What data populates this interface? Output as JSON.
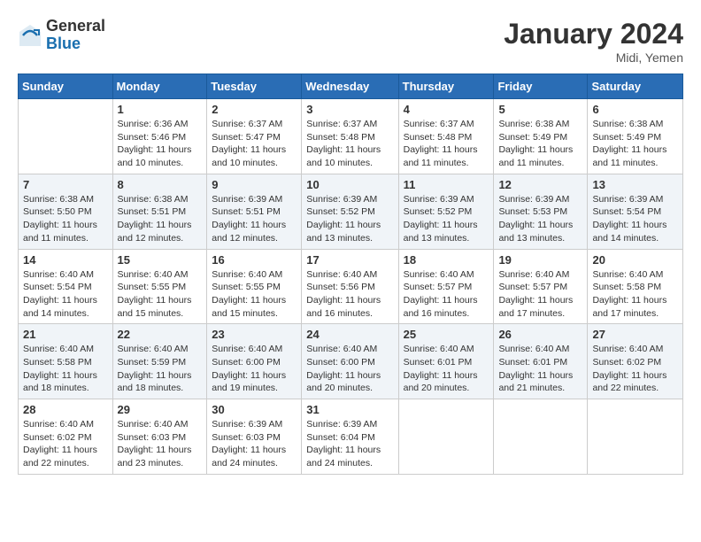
{
  "logo": {
    "general": "General",
    "blue": "Blue"
  },
  "title": "January 2024",
  "location": "Midi, Yemen",
  "headers": [
    "Sunday",
    "Monday",
    "Tuesday",
    "Wednesday",
    "Thursday",
    "Friday",
    "Saturday"
  ],
  "weeks": [
    [
      {
        "day": "",
        "sunrise": "",
        "sunset": "",
        "daylight": ""
      },
      {
        "day": "1",
        "sunrise": "Sunrise: 6:36 AM",
        "sunset": "Sunset: 5:46 PM",
        "daylight": "Daylight: 11 hours and 10 minutes."
      },
      {
        "day": "2",
        "sunrise": "Sunrise: 6:37 AM",
        "sunset": "Sunset: 5:47 PM",
        "daylight": "Daylight: 11 hours and 10 minutes."
      },
      {
        "day": "3",
        "sunrise": "Sunrise: 6:37 AM",
        "sunset": "Sunset: 5:48 PM",
        "daylight": "Daylight: 11 hours and 10 minutes."
      },
      {
        "day": "4",
        "sunrise": "Sunrise: 6:37 AM",
        "sunset": "Sunset: 5:48 PM",
        "daylight": "Daylight: 11 hours and 11 minutes."
      },
      {
        "day": "5",
        "sunrise": "Sunrise: 6:38 AM",
        "sunset": "Sunset: 5:49 PM",
        "daylight": "Daylight: 11 hours and 11 minutes."
      },
      {
        "day": "6",
        "sunrise": "Sunrise: 6:38 AM",
        "sunset": "Sunset: 5:49 PM",
        "daylight": "Daylight: 11 hours and 11 minutes."
      }
    ],
    [
      {
        "day": "7",
        "sunrise": "Sunrise: 6:38 AM",
        "sunset": "Sunset: 5:50 PM",
        "daylight": "Daylight: 11 hours and 11 minutes."
      },
      {
        "day": "8",
        "sunrise": "Sunrise: 6:38 AM",
        "sunset": "Sunset: 5:51 PM",
        "daylight": "Daylight: 11 hours and 12 minutes."
      },
      {
        "day": "9",
        "sunrise": "Sunrise: 6:39 AM",
        "sunset": "Sunset: 5:51 PM",
        "daylight": "Daylight: 11 hours and 12 minutes."
      },
      {
        "day": "10",
        "sunrise": "Sunrise: 6:39 AM",
        "sunset": "Sunset: 5:52 PM",
        "daylight": "Daylight: 11 hours and 13 minutes."
      },
      {
        "day": "11",
        "sunrise": "Sunrise: 6:39 AM",
        "sunset": "Sunset: 5:52 PM",
        "daylight": "Daylight: 11 hours and 13 minutes."
      },
      {
        "day": "12",
        "sunrise": "Sunrise: 6:39 AM",
        "sunset": "Sunset: 5:53 PM",
        "daylight": "Daylight: 11 hours and 13 minutes."
      },
      {
        "day": "13",
        "sunrise": "Sunrise: 6:39 AM",
        "sunset": "Sunset: 5:54 PM",
        "daylight": "Daylight: 11 hours and 14 minutes."
      }
    ],
    [
      {
        "day": "14",
        "sunrise": "Sunrise: 6:40 AM",
        "sunset": "Sunset: 5:54 PM",
        "daylight": "Daylight: 11 hours and 14 minutes."
      },
      {
        "day": "15",
        "sunrise": "Sunrise: 6:40 AM",
        "sunset": "Sunset: 5:55 PM",
        "daylight": "Daylight: 11 hours and 15 minutes."
      },
      {
        "day": "16",
        "sunrise": "Sunrise: 6:40 AM",
        "sunset": "Sunset: 5:55 PM",
        "daylight": "Daylight: 11 hours and 15 minutes."
      },
      {
        "day": "17",
        "sunrise": "Sunrise: 6:40 AM",
        "sunset": "Sunset: 5:56 PM",
        "daylight": "Daylight: 11 hours and 16 minutes."
      },
      {
        "day": "18",
        "sunrise": "Sunrise: 6:40 AM",
        "sunset": "Sunset: 5:57 PM",
        "daylight": "Daylight: 11 hours and 16 minutes."
      },
      {
        "day": "19",
        "sunrise": "Sunrise: 6:40 AM",
        "sunset": "Sunset: 5:57 PM",
        "daylight": "Daylight: 11 hours and 17 minutes."
      },
      {
        "day": "20",
        "sunrise": "Sunrise: 6:40 AM",
        "sunset": "Sunset: 5:58 PM",
        "daylight": "Daylight: 11 hours and 17 minutes."
      }
    ],
    [
      {
        "day": "21",
        "sunrise": "Sunrise: 6:40 AM",
        "sunset": "Sunset: 5:58 PM",
        "daylight": "Daylight: 11 hours and 18 minutes."
      },
      {
        "day": "22",
        "sunrise": "Sunrise: 6:40 AM",
        "sunset": "Sunset: 5:59 PM",
        "daylight": "Daylight: 11 hours and 18 minutes."
      },
      {
        "day": "23",
        "sunrise": "Sunrise: 6:40 AM",
        "sunset": "Sunset: 6:00 PM",
        "daylight": "Daylight: 11 hours and 19 minutes."
      },
      {
        "day": "24",
        "sunrise": "Sunrise: 6:40 AM",
        "sunset": "Sunset: 6:00 PM",
        "daylight": "Daylight: 11 hours and 20 minutes."
      },
      {
        "day": "25",
        "sunrise": "Sunrise: 6:40 AM",
        "sunset": "Sunset: 6:01 PM",
        "daylight": "Daylight: 11 hours and 20 minutes."
      },
      {
        "day": "26",
        "sunrise": "Sunrise: 6:40 AM",
        "sunset": "Sunset: 6:01 PM",
        "daylight": "Daylight: 11 hours and 21 minutes."
      },
      {
        "day": "27",
        "sunrise": "Sunrise: 6:40 AM",
        "sunset": "Sunset: 6:02 PM",
        "daylight": "Daylight: 11 hours and 22 minutes."
      }
    ],
    [
      {
        "day": "28",
        "sunrise": "Sunrise: 6:40 AM",
        "sunset": "Sunset: 6:02 PM",
        "daylight": "Daylight: 11 hours and 22 minutes."
      },
      {
        "day": "29",
        "sunrise": "Sunrise: 6:40 AM",
        "sunset": "Sunset: 6:03 PM",
        "daylight": "Daylight: 11 hours and 23 minutes."
      },
      {
        "day": "30",
        "sunrise": "Sunrise: 6:39 AM",
        "sunset": "Sunset: 6:03 PM",
        "daylight": "Daylight: 11 hours and 24 minutes."
      },
      {
        "day": "31",
        "sunrise": "Sunrise: 6:39 AM",
        "sunset": "Sunset: 6:04 PM",
        "daylight": "Daylight: 11 hours and 24 minutes."
      },
      {
        "day": "",
        "sunrise": "",
        "sunset": "",
        "daylight": ""
      },
      {
        "day": "",
        "sunrise": "",
        "sunset": "",
        "daylight": ""
      },
      {
        "day": "",
        "sunrise": "",
        "sunset": "",
        "daylight": ""
      }
    ]
  ]
}
